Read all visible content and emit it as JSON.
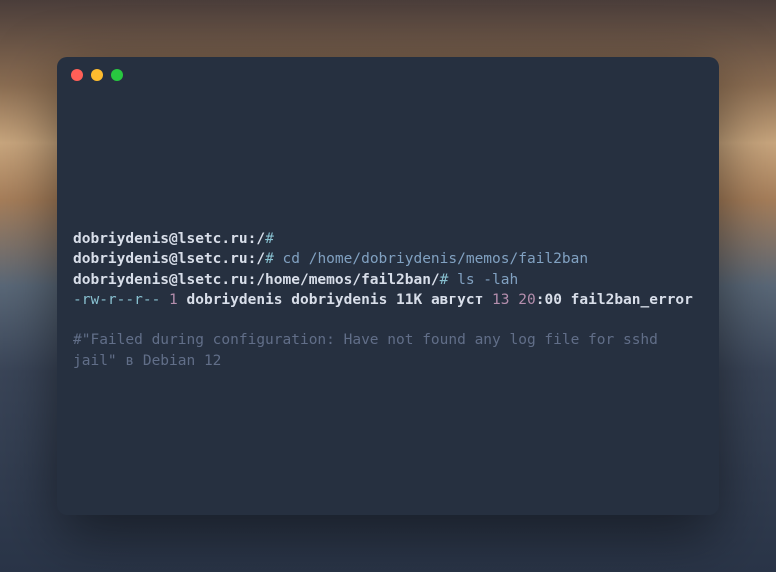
{
  "terminal": {
    "lines": {
      "l1_prompt": "dobriydenis@lsetc.ru:/",
      "l1_hash": "#",
      "l2_prompt": "dobriydenis@lsetc.ru:/",
      "l2_hash": "#",
      "l2_command": " cd /home/dobriydenis/memos/fail2ban",
      "l3_prompt": "dobriydenis@lsetc.ru:/home/memos/fail2ban/",
      "l3_hash": "#",
      "l3_command": " ls -lah",
      "l4_perms": "-rw-r--r--",
      "l4_num": " 1",
      "l4_user": " dobriydenis dobriydenis",
      "l4_size": " 11K",
      "l4_month": " август",
      "l4_date": " 13",
      "l4_timeh": " 20",
      "l4_colon": ":",
      "l4_timem": "00",
      "l4_filename": " fail2ban_error",
      "l5_comment": "#\"Failed during configuration: Have not found any log file for sshd jail\" в Debian 12"
    }
  }
}
